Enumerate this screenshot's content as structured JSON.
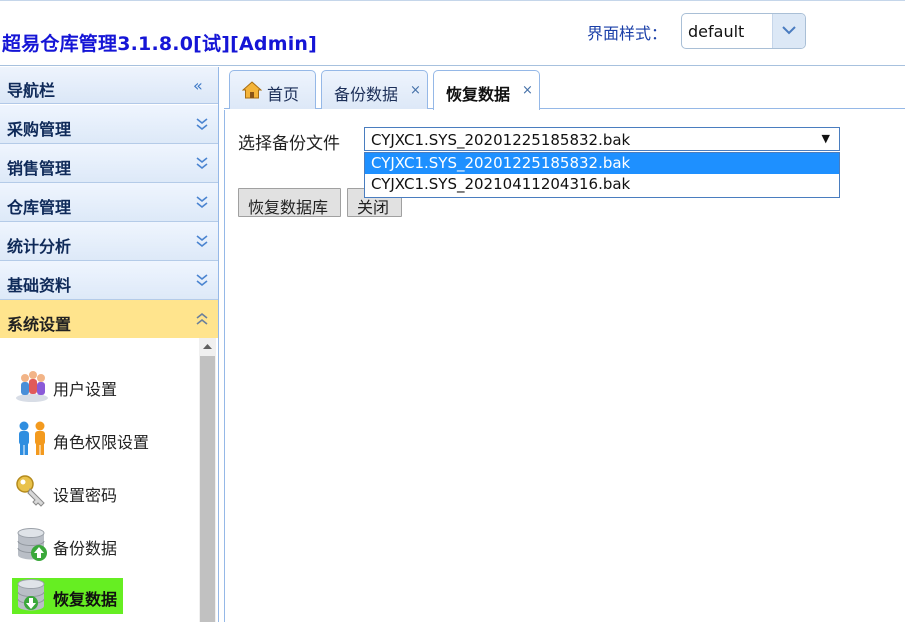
{
  "header": {
    "title": "超易仓库管理3.1.8.0[试][Admin]",
    "theme_label": "界面样式：",
    "theme_value": "default"
  },
  "sidebar": {
    "nav_title": "导航栏",
    "panels": [
      {
        "label": "采购管理"
      },
      {
        "label": "销售管理"
      },
      {
        "label": "仓库管理"
      },
      {
        "label": "统计分析"
      },
      {
        "label": "基础资料"
      },
      {
        "label": "系统设置"
      }
    ],
    "items": [
      {
        "label": "用户设置",
        "icon": "users-icon"
      },
      {
        "label": "角色权限设置",
        "icon": "roles-icon"
      },
      {
        "label": "设置密码",
        "icon": "key-icon"
      },
      {
        "label": "备份数据",
        "icon": "database-backup-icon"
      },
      {
        "label": "恢复数据",
        "icon": "database-restore-icon"
      }
    ]
  },
  "tabs": [
    {
      "label": "首页"
    },
    {
      "label": "备份数据",
      "close": "×"
    },
    {
      "label": "恢复数据",
      "close": "×"
    }
  ],
  "content": {
    "file_label": "选择备份文件",
    "selected_file": "CYJXC1.SYS_20201225185832.bak",
    "options": [
      "CYJXC1.SYS_20201225185832.bak",
      "CYJXC1.SYS_20210411204316.bak"
    ],
    "restore_button": "恢复数据库",
    "close_button": "关闭"
  }
}
